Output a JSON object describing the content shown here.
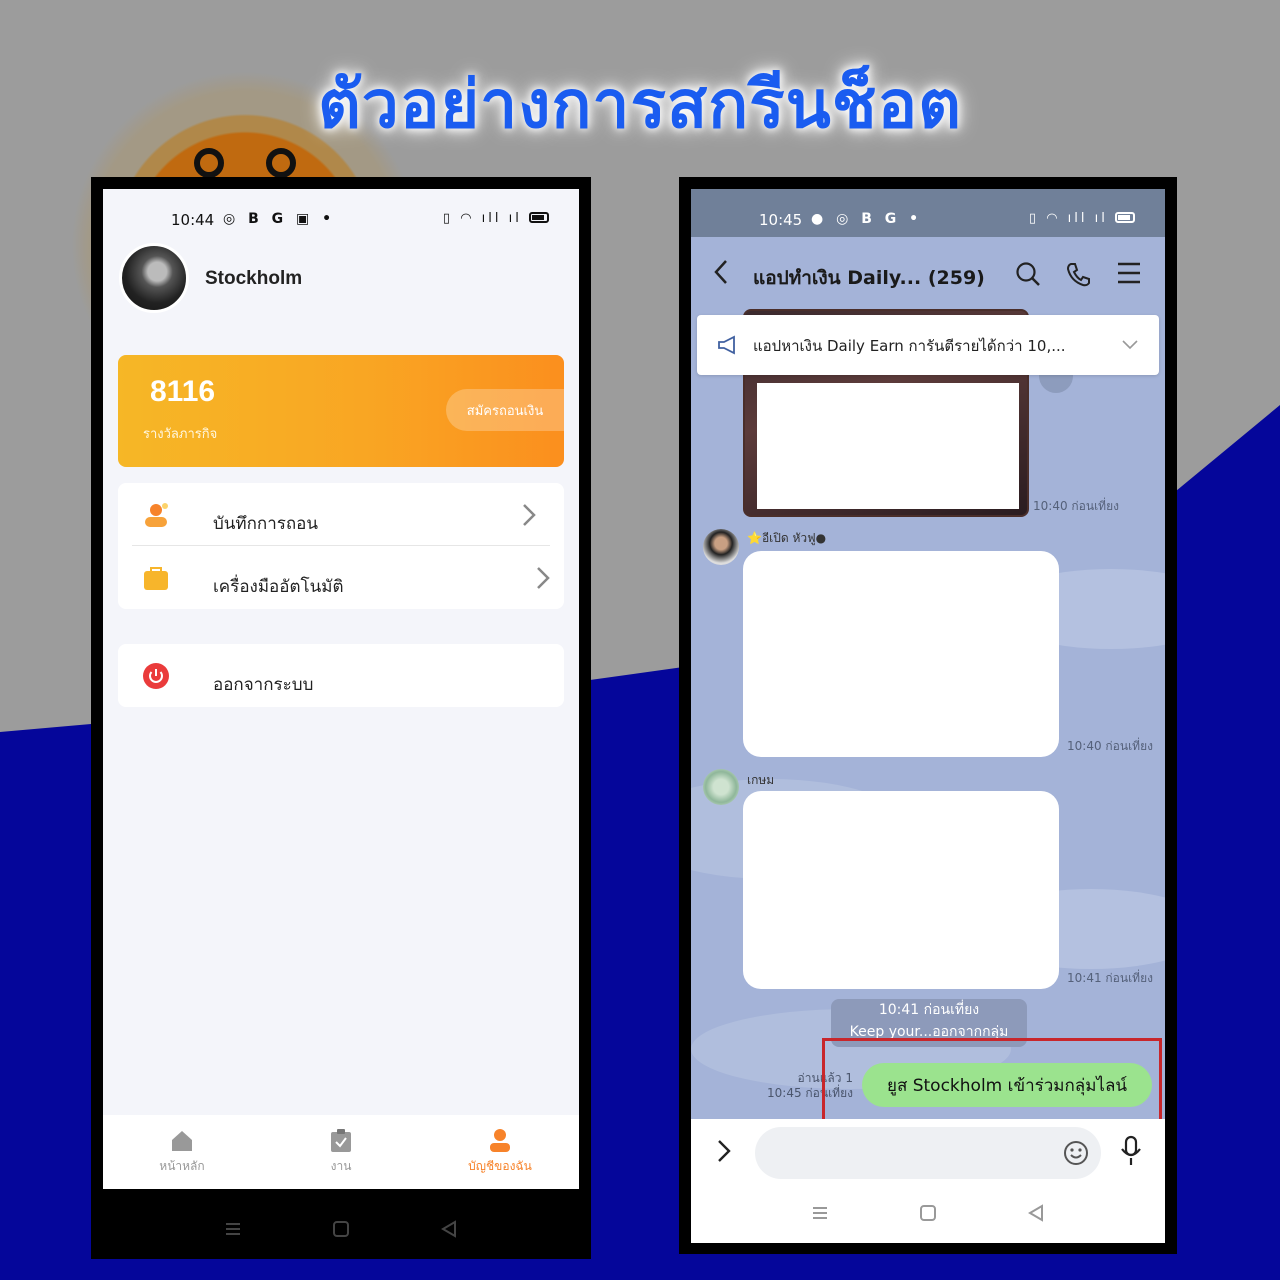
{
  "banner": {
    "title": "ตัวอย่างการสกรีนช็อต"
  },
  "left_phone": {
    "status": {
      "time": "10:44",
      "icons": "B G"
    },
    "profile": {
      "name": "Stockholm"
    },
    "reward": {
      "value": "8116",
      "label": "รางวัลภารกิจ",
      "button": "สมัครถอนเงิน"
    },
    "menu": [
      {
        "label": "บันทึกการถอน",
        "icon": "withdraw-record-icon"
      },
      {
        "label": "เครื่องมืออัตโนมัติ",
        "icon": "bag-icon"
      }
    ],
    "logout": {
      "label": "ออกจากระบบ",
      "icon": "power-icon"
    },
    "nav": [
      {
        "label": "หน้าหลัก",
        "icon": "home-icon"
      },
      {
        "label": "งาน",
        "icon": "clipboard-icon"
      },
      {
        "label": "บัญชีของฉัน",
        "icon": "user-icon"
      }
    ],
    "colors": {
      "accent": "#f7832a",
      "card_start": "#f6b726",
      "card_end": "#fb8f1e"
    }
  },
  "right_phone": {
    "status": {
      "time": "10:45",
      "icons": "B G"
    },
    "chat": {
      "title": "แอปทำเงิน Daily...",
      "count": "(259)"
    },
    "announcement": "แอปหาเงิน Daily Earn การันตีรายได้กว่า 10,...",
    "messages": [
      {
        "time": "10:40 ก่อนเที่ยง"
      },
      {
        "sender": "อีเปิด หัวฟู",
        "time": "10:40 ก่อนเที่ยง"
      },
      {
        "sender": "เกษม",
        "time": "10:41 ก่อนเที่ยง"
      }
    ],
    "system_message": {
      "time": "10:41 ก่อนเที่ยง",
      "text": "Keep your...ออกจากกลุ่ม"
    },
    "my_message": {
      "text": "ยูส Stockholm เข้าร่วมกลุ่มไลน์",
      "read": "อ่านแล้ว 1",
      "time": "10:45 ก่อนเที่ยง"
    },
    "colors": {
      "chat_bg": "#a4b3d8",
      "my_bubble": "#9be38e",
      "highlight": "#c8262b"
    }
  }
}
